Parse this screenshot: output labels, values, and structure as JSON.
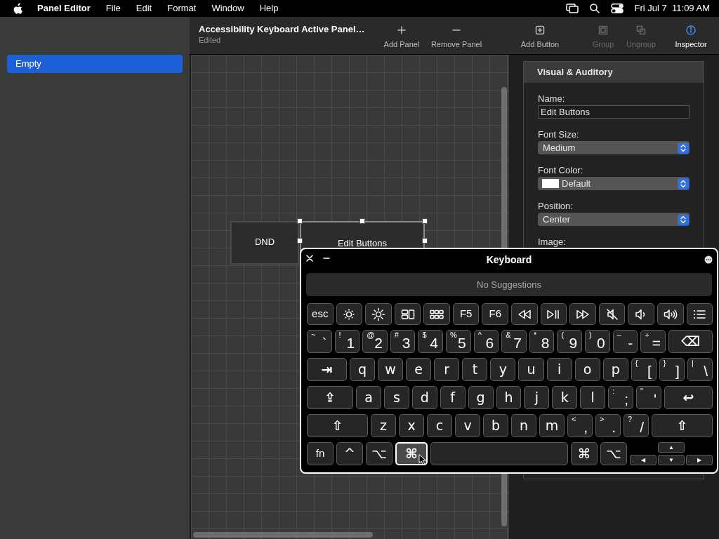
{
  "menu_bar": {
    "app_name": "Panel Editor",
    "menus": [
      "File",
      "Edit",
      "Format",
      "Window",
      "Help"
    ],
    "clock": "Fri Jul 7  11:09 AM"
  },
  "sidebar": {
    "items": [
      {
        "label": "Empty",
        "selected": true
      }
    ]
  },
  "toolbar": {
    "title": "Accessibility Keyboard Active Panel…",
    "subtitle": "Edited",
    "buttons": [
      {
        "kind": "add",
        "label": "Add Panel",
        "disabled": false,
        "selected": false
      },
      {
        "kind": "remove",
        "label": "Remove Panel",
        "disabled": false,
        "selected": false
      },
      {
        "kind": "add-button",
        "label": "Add Button",
        "disabled": false,
        "selected": false
      },
      {
        "kind": "group",
        "label": "Group",
        "disabled": true,
        "selected": false
      },
      {
        "kind": "ungroup",
        "label": "Ungroup",
        "disabled": true,
        "selected": false
      },
      {
        "kind": "inspector",
        "label": "Inspector",
        "disabled": false,
        "selected": true
      }
    ]
  },
  "canvas": {
    "panels": [
      {
        "label": "DND",
        "selected": false
      },
      {
        "label": "Edit Buttons",
        "selected": true
      }
    ]
  },
  "inspector": {
    "section": "Visual & Auditory",
    "fields": [
      {
        "kind": "text",
        "label": "Name:",
        "value": "Edit Buttons"
      },
      {
        "kind": "popup",
        "label": "Font Size:",
        "value": "Medium"
      },
      {
        "kind": "color-popup",
        "label": "Font Color:",
        "value": "Default"
      },
      {
        "kind": "popup",
        "label": "Position:",
        "value": "Center"
      },
      {
        "kind": "label",
        "label": "Image:"
      }
    ]
  },
  "keyboard": {
    "title": "Keyboard",
    "suggestions": "No Suggestions",
    "rows": [
      [
        {
          "kind": "small",
          "label": "esc"
        },
        {
          "kind": "brightness-down"
        },
        {
          "kind": "brightness-up"
        },
        {
          "kind": "mission-control"
        },
        {
          "kind": "launchpad"
        },
        {
          "kind": "small",
          "label": "F5"
        },
        {
          "kind": "small",
          "label": "F6"
        },
        {
          "kind": "rewind"
        },
        {
          "kind": "play-pause"
        },
        {
          "kind": "fast-forward"
        },
        {
          "kind": "mute"
        },
        {
          "kind": "volume-down"
        },
        {
          "kind": "volume-up"
        },
        {
          "kind": "list"
        }
      ],
      [
        {
          "kind": "dual",
          "top": "~",
          "label": "`"
        },
        {
          "kind": "dual",
          "top": "!",
          "label": "1"
        },
        {
          "kind": "dual",
          "top": "@",
          "label": "2"
        },
        {
          "kind": "dual",
          "top": "#",
          "label": "3"
        },
        {
          "kind": "dual",
          "top": "$",
          "label": "4"
        },
        {
          "kind": "dual",
          "top": "%",
          "label": "5"
        },
        {
          "kind": "dual",
          "top": "^",
          "label": "6"
        },
        {
          "kind": "dual",
          "top": "&",
          "label": "7"
        },
        {
          "kind": "dual",
          "top": "*",
          "label": "8"
        },
        {
          "kind": "dual",
          "top": "(",
          "label": "9"
        },
        {
          "kind": "dual",
          "top": ")",
          "label": "0"
        },
        {
          "kind": "dual",
          "top": "–",
          "label": "-"
        },
        {
          "kind": "dual",
          "top": "+",
          "label": "="
        },
        {
          "kind": "delete",
          "label": "⌫"
        }
      ],
      [
        {
          "kind": "tab",
          "label": "⇥"
        },
        {
          "kind": "key",
          "label": "q"
        },
        {
          "kind": "key",
          "label": "w"
        },
        {
          "kind": "key",
          "label": "e"
        },
        {
          "kind": "key",
          "label": "r"
        },
        {
          "kind": "key",
          "label": "t"
        },
        {
          "kind": "key",
          "label": "y"
        },
        {
          "kind": "key",
          "label": "u"
        },
        {
          "kind": "key",
          "label": "i"
        },
        {
          "kind": "key",
          "label": "o"
        },
        {
          "kind": "key",
          "label": "p"
        },
        {
          "kind": "dual",
          "top": "{",
          "label": "["
        },
        {
          "kind": "dual",
          "top": "}",
          "label": "]"
        },
        {
          "kind": "dual",
          "top": "|",
          "label": "\\"
        }
      ],
      [
        {
          "kind": "caps",
          "label": "⇪"
        },
        {
          "kind": "key",
          "label": "a"
        },
        {
          "kind": "key",
          "label": "s"
        },
        {
          "kind": "key",
          "label": "d"
        },
        {
          "kind": "key",
          "label": "f"
        },
        {
          "kind": "key",
          "label": "g"
        },
        {
          "kind": "key",
          "label": "h"
        },
        {
          "kind": "key",
          "label": "j"
        },
        {
          "kind": "key",
          "label": "k"
        },
        {
          "kind": "key",
          "label": "l"
        },
        {
          "kind": "dual",
          "top": ":",
          "label": ";"
        },
        {
          "kind": "dual",
          "top": "\"",
          "label": "'"
        },
        {
          "kind": "return",
          "label": "↩"
        }
      ],
      [
        {
          "kind": "shift",
          "label": "⇧"
        },
        {
          "kind": "key",
          "label": "z"
        },
        {
          "kind": "key",
          "label": "x"
        },
        {
          "kind": "key",
          "label": "c"
        },
        {
          "kind": "key",
          "label": "v"
        },
        {
          "kind": "key",
          "label": "b"
        },
        {
          "kind": "key",
          "label": "n"
        },
        {
          "kind": "key",
          "label": "m"
        },
        {
          "kind": "dual",
          "top": "<",
          "label": ","
        },
        {
          "kind": "dual",
          "top": ">",
          "label": "."
        },
        {
          "kind": "dual",
          "top": "?",
          "label": "/"
        },
        {
          "kind": "shift",
          "label": "⇧"
        }
      ],
      [
        {
          "kind": "small",
          "label": "fn",
          "highlighted": false
        },
        {
          "kind": "key",
          "label": "^",
          "highlighted": false
        },
        {
          "kind": "key",
          "label": "⌥",
          "highlighted": false
        },
        {
          "kind": "command",
          "label": "⌘",
          "highlighted": true
        },
        {
          "kind": "space",
          "highlighted": false
        },
        {
          "kind": "key",
          "label": "⌘",
          "highlighted": false
        },
        {
          "kind": "key",
          "label": "⌥",
          "highlighted": false
        }
      ]
    ],
    "arrow_keys": {
      "labels": [
        "▲",
        "◀",
        "▼",
        "▶"
      ]
    }
  }
}
